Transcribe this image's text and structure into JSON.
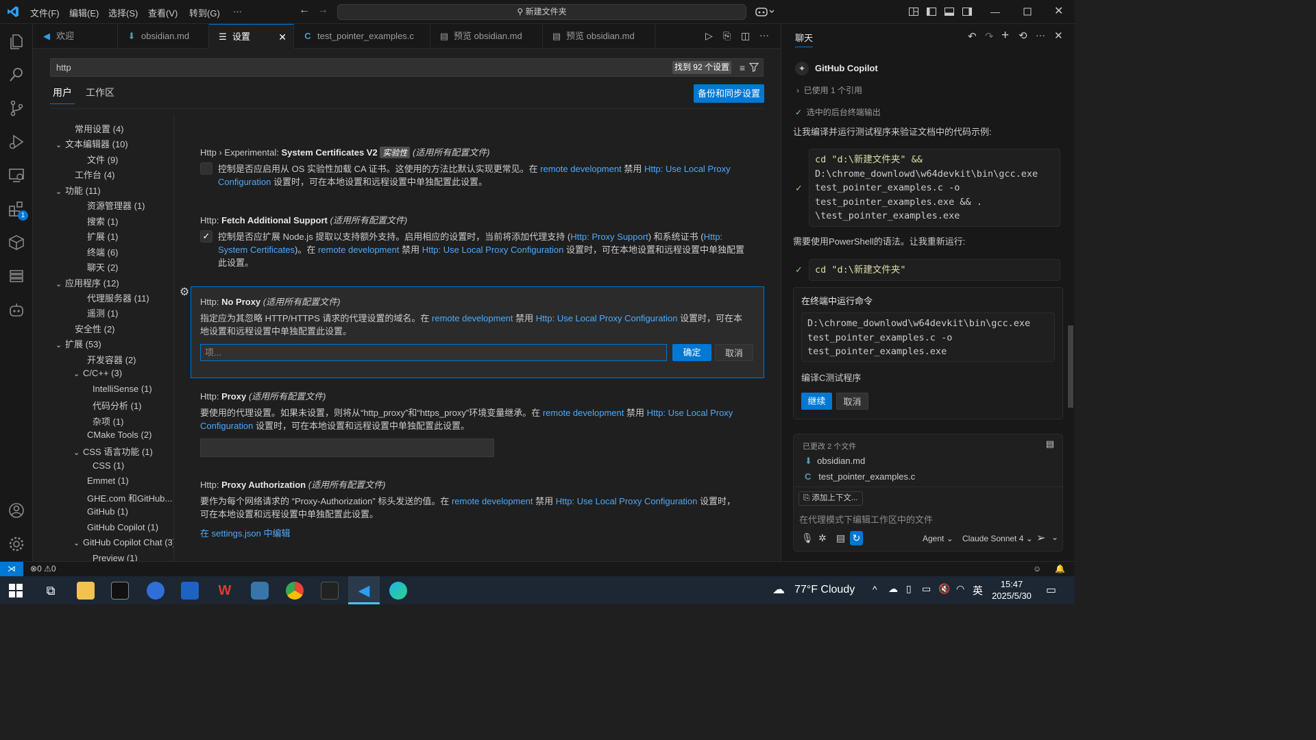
{
  "titlebar": {
    "menus": [
      "文件(F)",
      "编辑(E)",
      "选择(S)",
      "查看(V)",
      "转到(G)",
      "···"
    ],
    "command_center": "新建文件夹"
  },
  "activity": {
    "extensions_badge": "1"
  },
  "tabs": [
    {
      "icon": "vscode",
      "label": "欢迎"
    },
    {
      "icon": "markdown",
      "label": "obsidian.md"
    },
    {
      "icon": "settings",
      "label": "设置",
      "active": true
    },
    {
      "icon": "c",
      "label": "test_pointer_examples.c"
    },
    {
      "icon": "preview",
      "label": "预览 obsidian.md"
    },
    {
      "icon": "preview",
      "label": "预览 obsidian.md"
    }
  ],
  "settings_editor": {
    "search_value": "http",
    "result_count": "找到 92 个设置",
    "scope_tabs": [
      "用户",
      "工作区"
    ],
    "sync_button": "备份和同步设置",
    "toc": [
      {
        "label": "常用设置 (4)",
        "level": 1,
        "chevron": ""
      },
      {
        "label": "文本编辑器 (10)",
        "level": 0,
        "chevron": "v"
      },
      {
        "label": "文件 (9)",
        "level": 2,
        "chevron": ""
      },
      {
        "label": "工作台 (4)",
        "level": 1,
        "chevron": ""
      },
      {
        "label": "功能 (11)",
        "level": 0,
        "chevron": "v"
      },
      {
        "label": "资源管理器 (1)",
        "level": 2,
        "chevron": ""
      },
      {
        "label": "搜索 (1)",
        "level": 2,
        "chevron": ""
      },
      {
        "label": "扩展 (1)",
        "level": 2,
        "chevron": ""
      },
      {
        "label": "终端 (6)",
        "level": 2,
        "chevron": ""
      },
      {
        "label": "聊天 (2)",
        "level": 2,
        "chevron": ""
      },
      {
        "label": "应用程序 (12)",
        "level": 0,
        "chevron": "v"
      },
      {
        "label": "代理服务器 (11)",
        "level": 2,
        "chevron": ""
      },
      {
        "label": "遥测 (1)",
        "level": 2,
        "chevron": ""
      },
      {
        "label": "安全性 (2)",
        "level": 1,
        "chevron": ""
      },
      {
        "label": "扩展 (53)",
        "level": 0,
        "chevron": "v"
      },
      {
        "label": "开发容器 (2)",
        "level": 2,
        "chevron": ""
      },
      {
        "label": "C/C++ (3)",
        "level": 1.5,
        "chevron": "v"
      },
      {
        "label": "IntelliSense (1)",
        "level": 3,
        "chevron": ""
      },
      {
        "label": "代码分析 (1)",
        "level": 3,
        "chevron": ""
      },
      {
        "label": "杂项 (1)",
        "level": 3,
        "chevron": ""
      },
      {
        "label": "CMake Tools (2)",
        "level": 2,
        "chevron": ""
      },
      {
        "label": "CSS 语言功能 (1)",
        "level": 1.5,
        "chevron": "v"
      },
      {
        "label": "CSS (1)",
        "level": 3,
        "chevron": ""
      },
      {
        "label": "Emmet (1)",
        "level": 2,
        "chevron": ""
      },
      {
        "label": "GHE.com 和GitHub... (1)",
        "level": 2,
        "chevron": ""
      },
      {
        "label": "GitHub (1)",
        "level": 2,
        "chevron": ""
      },
      {
        "label": "GitHub Copilot (1)",
        "level": 2,
        "chevron": ""
      },
      {
        "label": "GitHub Copilot Chat (3)",
        "level": 1.5,
        "chevron": "v"
      },
      {
        "label": "Preview (1)",
        "level": 3,
        "chevron": ""
      }
    ],
    "s1": {
      "prefix": "Http › Experimental: ",
      "name": "System Certificates V2",
      "badge": "实验性",
      "scope": "(适用所有配置文件)",
      "d1": "控制是否应启用从 OS 实验性加载 CA 证书。这使用的方法比默认实现更常见。在 ",
      "l1": "remote development",
      "d2": " 禁用 ",
      "l2": "Http: Use Local Proxy",
      "l3": "Configuration",
      "d3": " 设置时，可在本地设置和远程设置中单独配置此设置。"
    },
    "s2": {
      "prefix": "Http: ",
      "name": "Fetch Additional Support",
      "scope": "(适用所有配置文件)",
      "d1": "控制是否应扩展 Node.js 提取以支持额外支持。启用相应的设置时，当前将添加代理支持 (",
      "l1": "Http: Proxy Support",
      "d2": ") 和系统证书 (",
      "l2": "Http:",
      "l3": "System Certificates",
      "d3": ")。在 ",
      "l4": "remote development",
      "d4": " 禁用 ",
      "l5": "Http: Use Local Proxy Configuration",
      "d5": " 设置时，可在本地设置和远程设置中单独配置",
      "d6": "此设置。"
    },
    "s3": {
      "prefix": "Http: ",
      "name": "No Proxy",
      "scope": "(适用所有配置文件)",
      "d1": "指定应为其忽略 HTTP/HTTPS 请求的代理设置的域名。在 ",
      "l1": "remote development",
      "d2": " 禁用 ",
      "l2": "Http: Use Local Proxy Configuration",
      "d3": " 设置时，可在本",
      "d4": "地设置和远程设置中单独配置此设置。",
      "placeholder": "项...",
      "ok": "确定",
      "cancel": "取消"
    },
    "s4": {
      "prefix": "Http: ",
      "name": "Proxy",
      "scope": "(适用所有配置文件)",
      "d1": "要使用的代理设置。如果未设置，则将从“http_proxy”和“https_proxy”环境变量继承。在 ",
      "l1": "remote development",
      "d2": " 禁用 ",
      "l2": "Http: Use Local Proxy",
      "l3": "Configuration",
      "d3": " 设置时，可在本地设置和远程设置中单独配置此设置。",
      "value": ""
    },
    "s5": {
      "prefix": "Http: ",
      "name": "Proxy Authorization",
      "scope": "(适用所有配置文件)",
      "d1": "要作为每个网络请求的 “Proxy-Authorization” 标头发送的值。在 ",
      "l1": "remote development",
      "d2": " 禁用 ",
      "l2": "Http: Use Local Proxy Configuration",
      "d3": " 设置时，",
      "d4": "可在本地设置和远程设置中单独配置此设置。",
      "link": "在 settings.json 中编辑"
    }
  },
  "chat": {
    "tab": "聊天",
    "participant": "GitHub Copilot",
    "refs": "已使用 1 个引用",
    "terminal_out": "选中的后台终端输出",
    "msg1": "让我编译并运行测试程序来验证文档中的代码示例:",
    "code1": [
      "cd \"d:\\新建文件夹\" &&",
      "D:\\chrome_downlowd\\w64devkit\\bin\\gcc.exe",
      "test_pointer_examples.c -o",
      "test_pointer_examples.exe && .",
      "\\test_pointer_examples.exe"
    ],
    "msg2": "需要使用PowerShell的语法。让我重新运行:",
    "code2": "cd \"d:\\新建文件夹\"",
    "run_title": "在终端中运行命令",
    "code3": [
      "D:\\chrome_downlowd\\w64devkit\\bin\\gcc.exe",
      "test_pointer_examples.c -o",
      "test_pointer_examples.exe"
    ],
    "run_desc": "编译C测试程序",
    "continue": "继续",
    "cancel": "取消",
    "changed": "已更改 2 个文件",
    "files": [
      "obsidian.md",
      "test_pointer_examples.c"
    ],
    "add_context": "添加上下文...",
    "input_placeholder": "在代理模式下编辑工作区中的文件",
    "mode": "Agent",
    "model": "Claude Sonnet 4"
  },
  "statusbar": {
    "problems": "0",
    "warnings": "0"
  },
  "taskbar": {
    "weather": "77°F  Cloudy",
    "ime": "英",
    "time": "15:47",
    "date": "2025/5/30"
  },
  "colors": {
    "accent": "#0078d4",
    "link": "#4daafc",
    "background": "#1f1f1f",
    "sidebar": "#181818"
  }
}
